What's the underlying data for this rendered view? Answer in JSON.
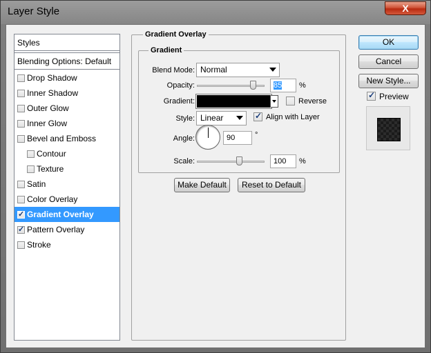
{
  "window": {
    "title": "Layer Style",
    "close_glyph": "X"
  },
  "styles_list": {
    "header": "Styles",
    "blending_default": "Blending Options: Default",
    "items": [
      {
        "label": "Drop Shadow",
        "checked": false
      },
      {
        "label": "Inner Shadow",
        "checked": false
      },
      {
        "label": "Outer Glow",
        "checked": false
      },
      {
        "label": "Inner Glow",
        "checked": false
      },
      {
        "label": "Bevel and Emboss",
        "checked": false
      },
      {
        "label": "Contour",
        "checked": false
      },
      {
        "label": "Texture",
        "checked": false
      },
      {
        "label": "Satin",
        "checked": false
      },
      {
        "label": "Color Overlay",
        "checked": false
      },
      {
        "label": "Gradient Overlay",
        "checked": true,
        "selected": true
      },
      {
        "label": "Pattern Overlay",
        "checked": true
      },
      {
        "label": "Stroke",
        "checked": false
      }
    ]
  },
  "panel": {
    "title": "Gradient Overlay",
    "group_title": "Gradient",
    "blend_mode": {
      "label": "Blend Mode:",
      "value": "Normal"
    },
    "opacity": {
      "label": "Opacity:",
      "value": "85",
      "unit": "%"
    },
    "gradient": {
      "label": "Gradient:",
      "reverse_label": "Reverse",
      "reverse_checked": false
    },
    "style": {
      "label": "Style:",
      "value": "Linear",
      "align_label": "Align with Layer",
      "align_checked": true
    },
    "angle": {
      "label": "Angle:",
      "value": "90",
      "unit": "°"
    },
    "scale": {
      "label": "Scale:",
      "value": "100",
      "unit": "%"
    },
    "make_default": "Make Default",
    "reset_default": "Reset to Default"
  },
  "actions": {
    "ok": "OK",
    "cancel": "Cancel",
    "new_style": "New Style...",
    "preview_label": "Preview",
    "preview_checked": true
  }
}
